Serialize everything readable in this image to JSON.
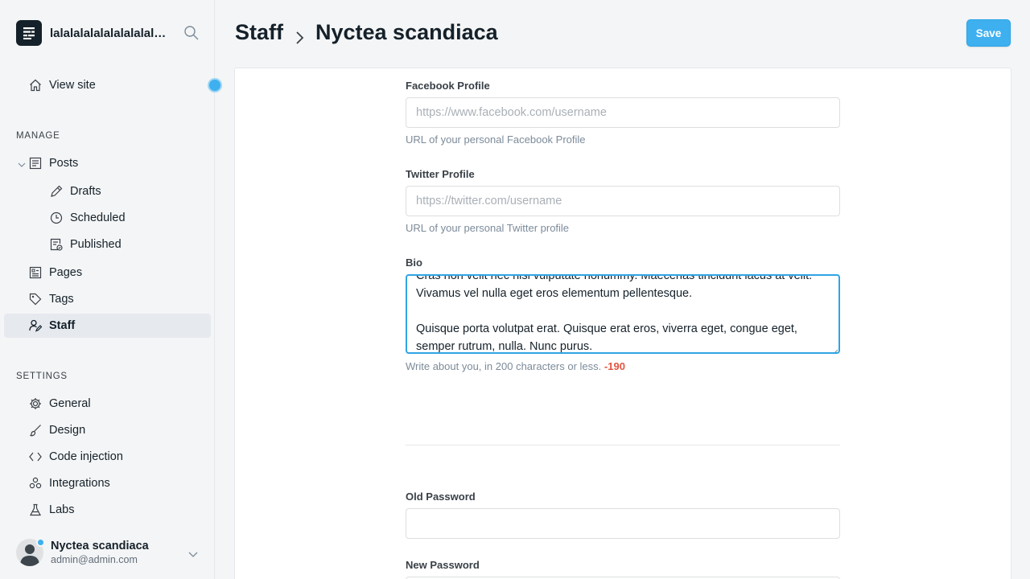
{
  "sidebar": {
    "site_name": "lalalalalalalalalalalalalalala",
    "view_site": "View site",
    "manage_heading": "MANAGE",
    "posts": "Posts",
    "drafts": "Drafts",
    "scheduled": "Scheduled",
    "published": "Published",
    "pages": "Pages",
    "tags": "Tags",
    "staff": "Staff",
    "settings_heading": "SETTINGS",
    "general": "General",
    "design": "Design",
    "code_injection": "Code injection",
    "integrations": "Integrations",
    "labs": "Labs"
  },
  "user": {
    "name": "Nyctea scandiaca",
    "email": "admin@admin.com"
  },
  "header": {
    "breadcrumb_parent": "Staff",
    "breadcrumb_current": "Nyctea scandiaca",
    "save_label": "Save"
  },
  "form": {
    "facebook": {
      "label": "Facebook Profile",
      "placeholder": "https://www.facebook.com/username",
      "help": "URL of your personal Facebook Profile"
    },
    "twitter": {
      "label": "Twitter Profile",
      "placeholder": "https://twitter.com/username",
      "help": "URL of your personal Twitter profile"
    },
    "bio": {
      "label": "Bio",
      "value": "Cras non velit nec nisi vulputate nonummy. Maecenas tincidunt lacus at velit. Vivamus vel nulla eget eros elementum pellentesque.\n\nQuisque porta volutpat erat. Quisque erat eros, viverra eget, congue eget, semper rutrum, nulla. Nunc purus.",
      "help": "Write about you, in 200 characters or less.",
      "remaining": "-190"
    },
    "old_password": {
      "label": "Old Password"
    },
    "new_password": {
      "label": "New Password"
    }
  },
  "colors": {
    "accent": "#3eb0ef",
    "error": "#e25440",
    "sidebar_bg": "#f4f5f6",
    "active_item_bg": "#e6eaef"
  }
}
